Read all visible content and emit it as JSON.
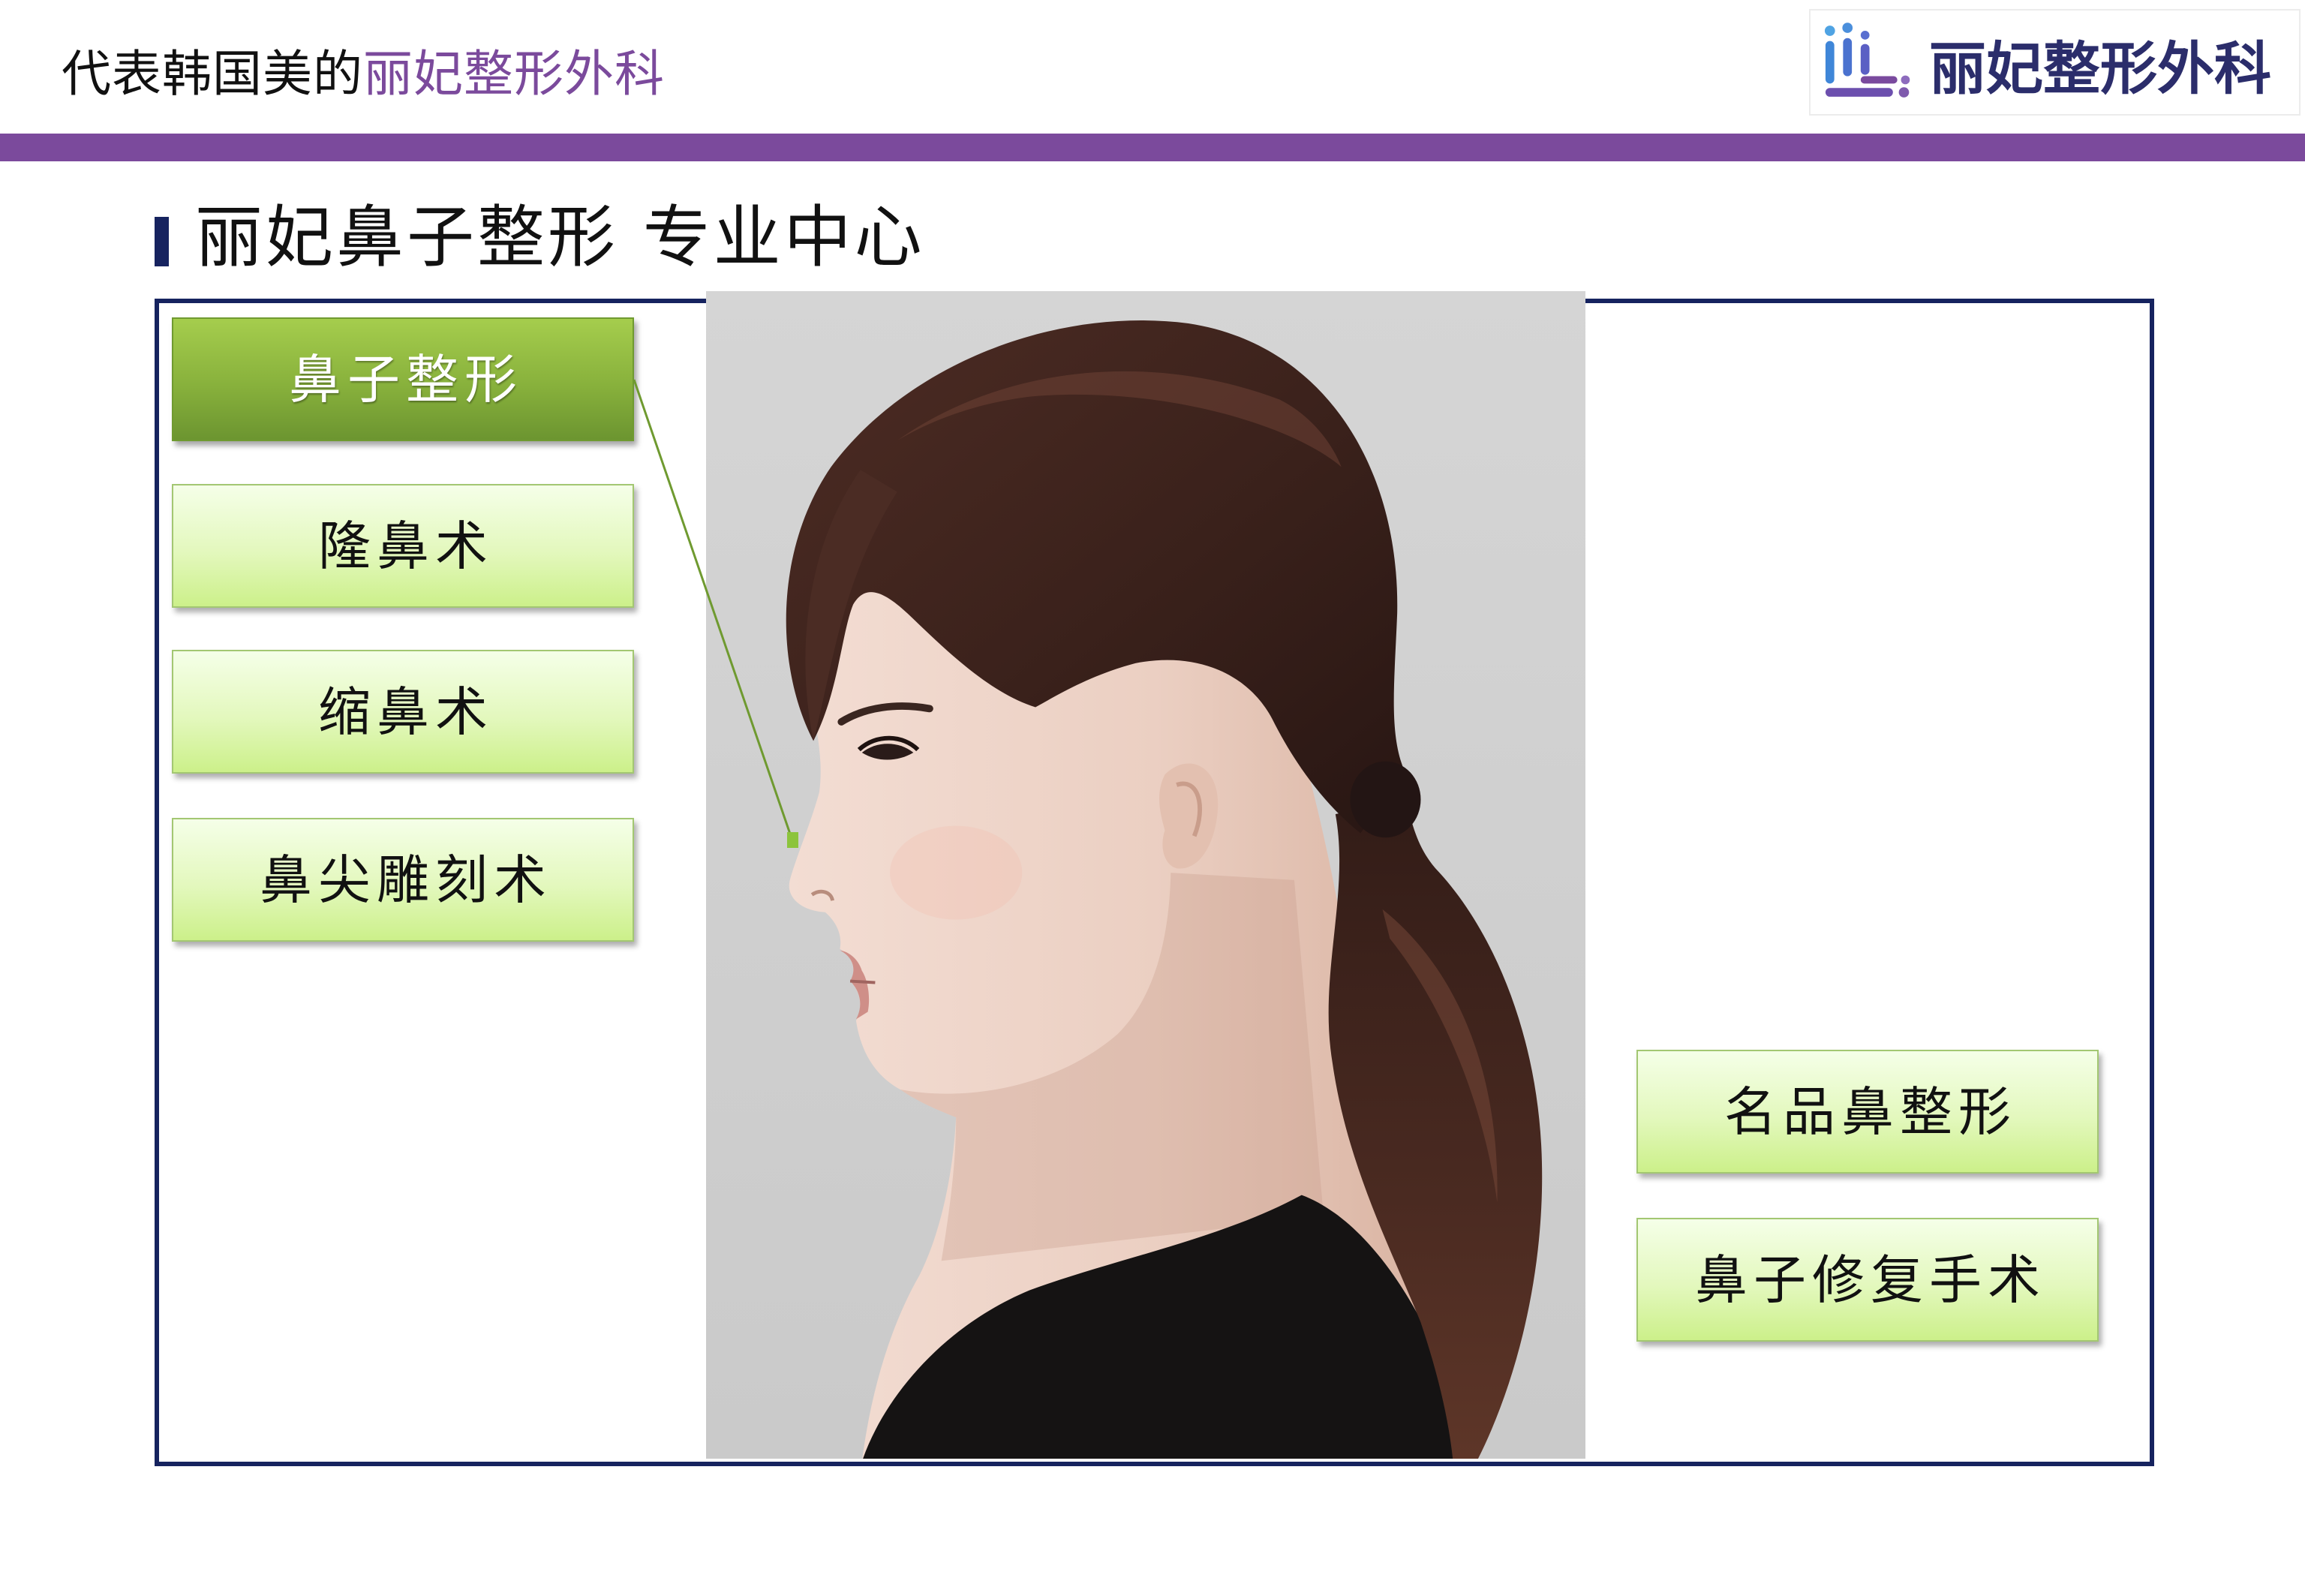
{
  "header": {
    "tagline_prefix": "代表韩国美的",
    "tagline_brand": "丽妃整形外科",
    "logo_text": "丽妃整形外科",
    "logo_icon": "clinic-logo-mark"
  },
  "section": {
    "title": "丽妃鼻子整形 专业中心"
  },
  "menu": {
    "primary_label": "鼻子整形",
    "left_items": [
      "隆鼻术",
      "缩鼻术",
      "鼻尖雕刻术"
    ],
    "right_items": [
      "名品鼻整形",
      "鼻子修复手术"
    ]
  },
  "colors": {
    "brand_purple": "#7b4a9c",
    "navy": "#16235f",
    "green_accent": "#8cc43c",
    "green_dark": "#6f9a30",
    "logo_text": "#2b2d6b"
  }
}
